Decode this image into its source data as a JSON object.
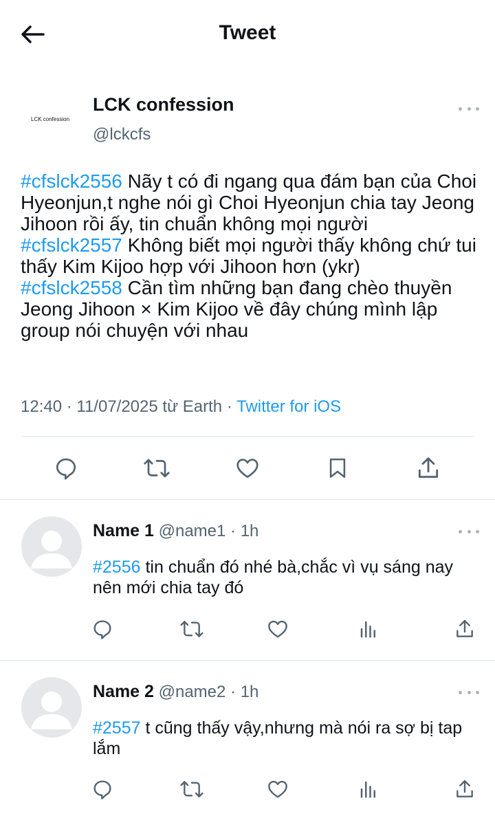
{
  "header": {
    "title": "Tweet",
    "back_icon": "arrow-left-icon"
  },
  "tweet": {
    "author": {
      "name": "LCK confession",
      "handle": "@lckcfs",
      "avatar_text": "LCK confession"
    },
    "paragraphs": [
      {
        "tag": "#cfslck2556",
        "text": " Nãy t có đi ngang qua đám bạn của Choi Hyeonjun,t nghe nói gì Choi Hyeonjun chia tay Jeong Jihoon rồi ấy, tin chuẩn không mọi người"
      },
      {
        "tag": "#cfslck2557",
        "text": " Không biết mọi người thấy không chứ tui thấy Kim Kijoo hợp với Jihoon hơn (ykr)"
      },
      {
        "tag": "#cfslck2558",
        "text": " Cần tìm những bạn đang chèo thuyền Jeong Jihoon × Kim Kijoo về đây chúng mình lập group nói chuyện với nhau"
      }
    ],
    "meta": {
      "time": "12:40 · 11/07/2025 từ Earth · ",
      "source": "Twitter for iOS"
    },
    "actions": [
      "reply-icon",
      "retweet-icon",
      "like-icon",
      "bookmark-icon",
      "share-icon"
    ]
  },
  "replies": [
    {
      "name": "Name 1",
      "handle": " @name1 · 1h",
      "tag": "#2556",
      "text": " tin chuẩn đó nhé bà,chắc vì vụ sáng nay nên mới chia tay đó"
    },
    {
      "name": "Name 2",
      "handle": " @name2 · 1h",
      "tag": "#2557",
      "text": " t cũng thấy vậy,nhưng mà nói ra sợ bị tap lắm"
    }
  ],
  "colors": {
    "accent": "#1d9bf0",
    "muted": "#536471",
    "divider": "#e1e6ea",
    "icon": "#536471"
  }
}
